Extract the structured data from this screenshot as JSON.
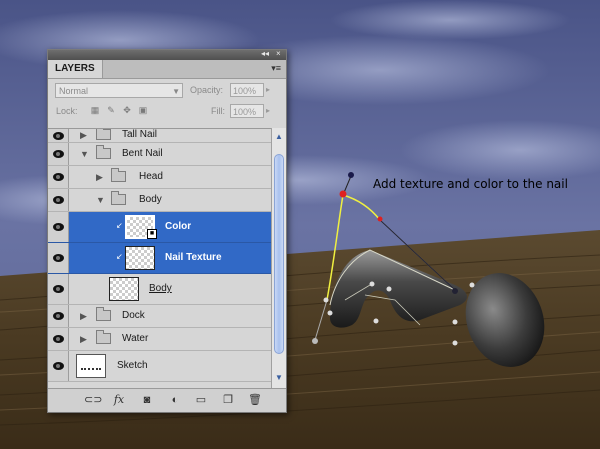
{
  "annotation": "Add texture and color to the nail",
  "panel": {
    "collapse_icon": "double-arrow-left-icon",
    "close_label": "×",
    "tab_label": "LAYERS",
    "menu_icon": "panel-menu-icon",
    "blend_mode": "Normal",
    "opacity_label": "Opacity:",
    "opacity_value": "100%",
    "lock_label": "Lock:",
    "fill_label": "Fill:",
    "fill_value": "100%",
    "layers": [
      {
        "name": "Tall Nail"
      },
      {
        "name": "Bent Nail"
      },
      {
        "name": "Head"
      },
      {
        "name": "Body"
      },
      {
        "name": "Color"
      },
      {
        "name": "Nail Texture"
      },
      {
        "name": "Body"
      },
      {
        "name": "Dock"
      },
      {
        "name": "Water"
      },
      {
        "name": "Sketch"
      }
    ],
    "bottom_icons": [
      "link-layers-icon",
      "fx-icon",
      "add-mask-icon",
      "adjustment-layer-icon",
      "new-group-icon",
      "new-layer-icon",
      "trash-icon"
    ],
    "fx_label": "fx"
  },
  "colors": {
    "selection": "#3169c6",
    "path_highlight": "#f0f040",
    "sky": "#56608f",
    "wood": "#4a3a24"
  }
}
